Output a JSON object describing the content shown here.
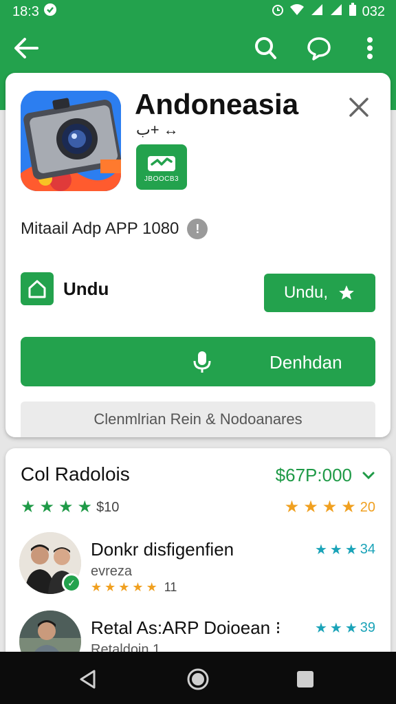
{
  "status_bar": {
    "time": "18:3",
    "battery": "032"
  },
  "app": {
    "name": "Andoneasia",
    "subtitle": "ب+ ↔",
    "badge_label": "JBOOCB3",
    "meta_line": "Mitaail Adp APP 1080",
    "undu_label": "Undu",
    "undu_button": "Undu,",
    "download_label": "Denhdan",
    "secondary_label": "Clenmlrian Rein & Nodoanares"
  },
  "reviews_section": {
    "title": "Col Radolois",
    "price": "$67P:000",
    "left_rating": "$10",
    "right_rating": "20",
    "reviews": [
      {
        "name": "Donkr disfigenfien",
        "sub": "evreza",
        "stars": "11",
        "score": "34"
      },
      {
        "name": "Retal As:ARP Doioean ⁝",
        "sub": "Retaldoin 1",
        "stars": "",
        "score": "39"
      }
    ]
  },
  "colors": {
    "primary_green": "#23a24d",
    "price_green": "#1f9a47",
    "star_orange": "#f0a020",
    "star_teal": "#1aa3b8",
    "navbar": "#0c0c0c"
  },
  "icons": {
    "back": "arrow-left-icon",
    "search": "search-icon",
    "chat": "chat-bubble-icon",
    "menu": "more-vert-icon",
    "close": "close-icon"
  }
}
